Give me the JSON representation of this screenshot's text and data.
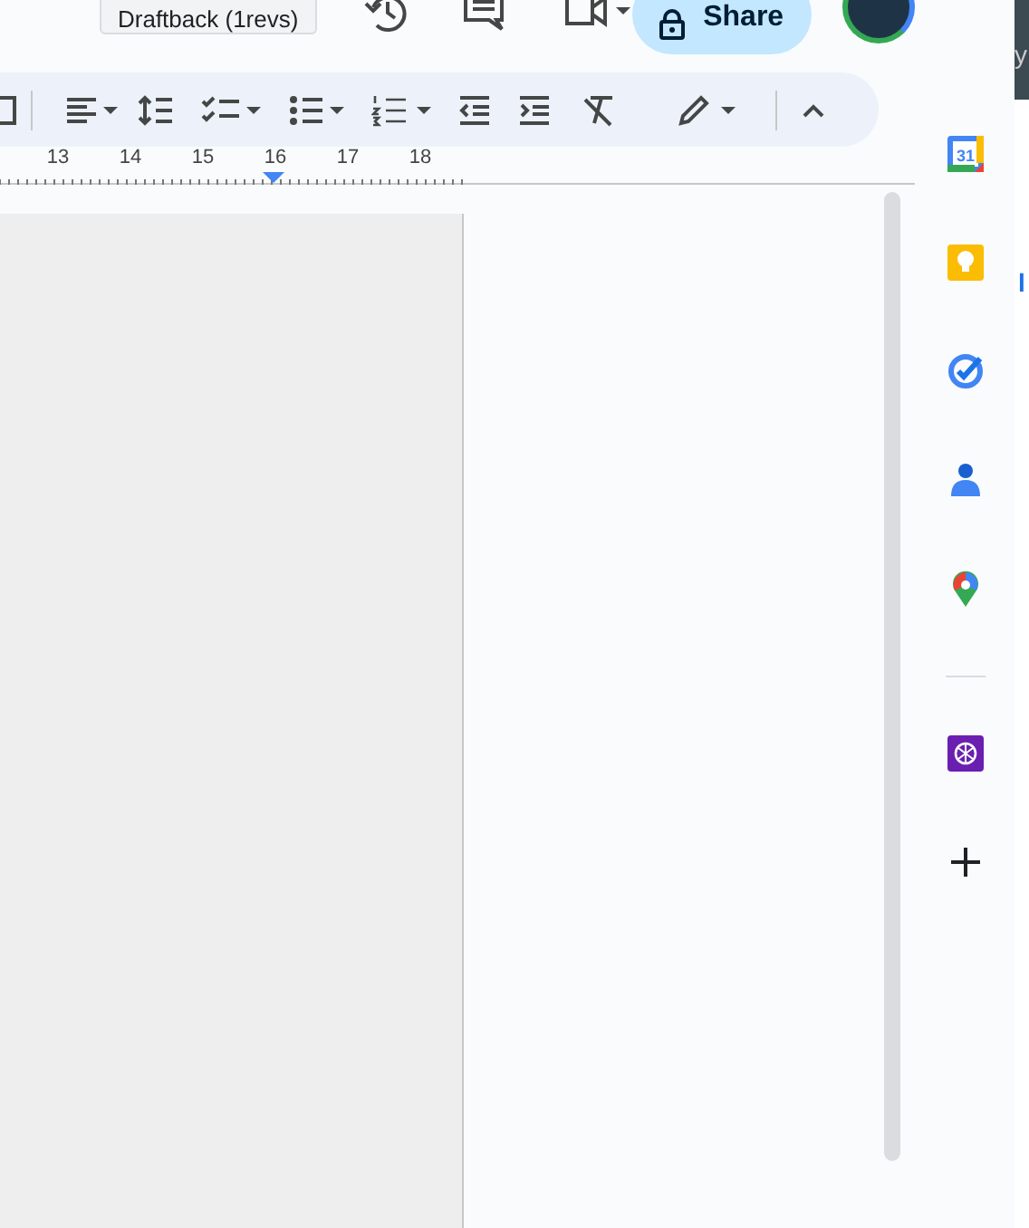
{
  "header": {
    "tooltip": "Draftback (1revs)",
    "share_label": "Share"
  },
  "ruler": {
    "labels": [
      "13",
      "14",
      "15",
      "16",
      "17",
      "18"
    ]
  },
  "side_panel": {
    "calendar_day": "31"
  },
  "edge_texts": [
    "y",
    "l"
  ]
}
